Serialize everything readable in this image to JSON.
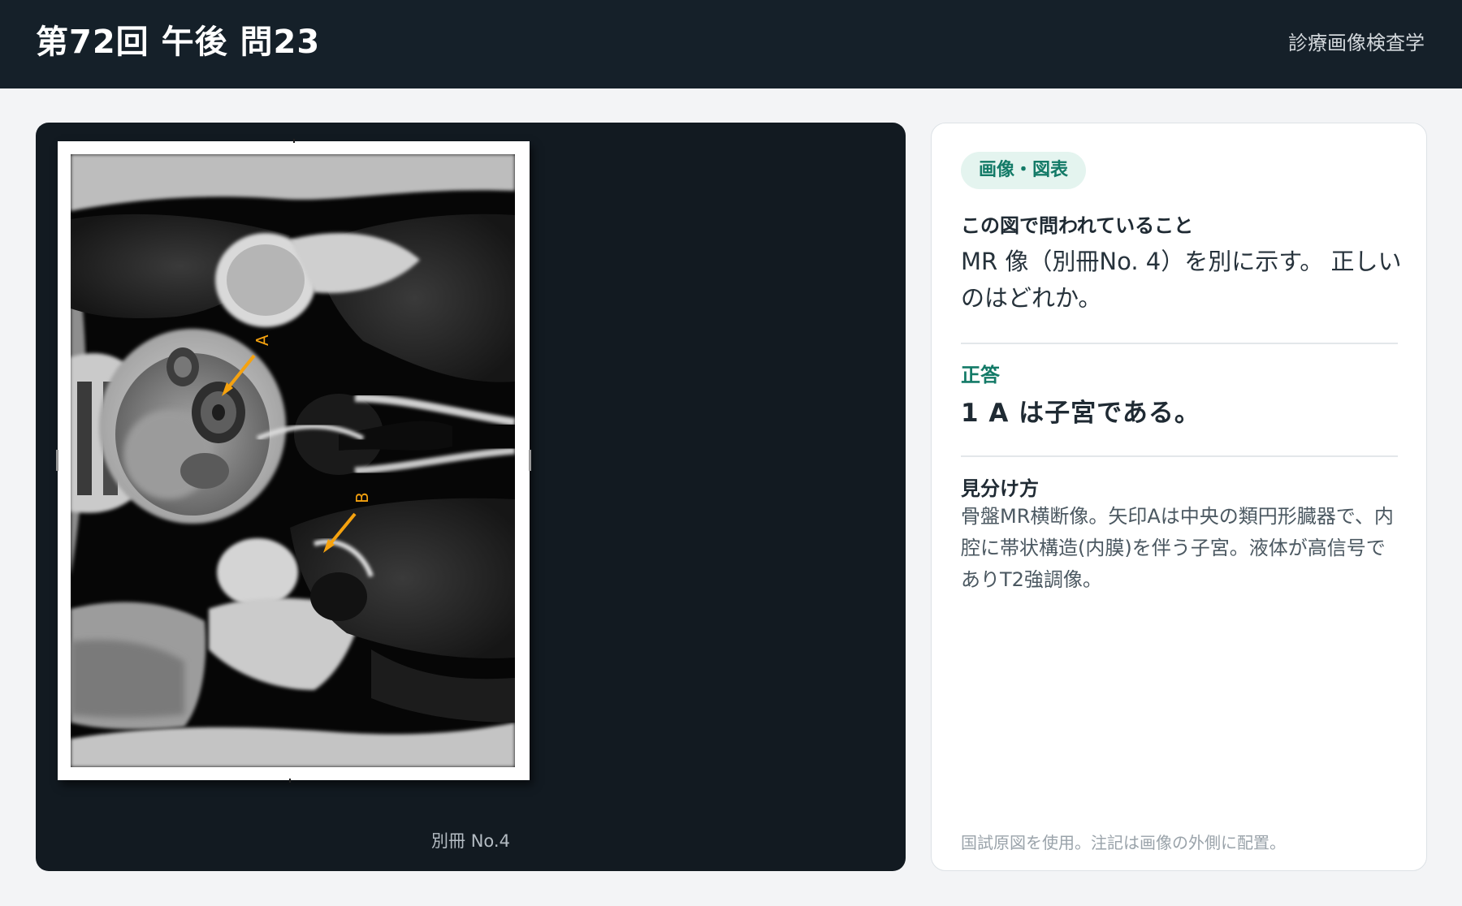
{
  "header": {
    "title": "第72回 午後 問23",
    "subject": "診療画像検査学"
  },
  "viewer": {
    "caption": "別冊 No.4",
    "arrow_labels": [
      "A",
      "B"
    ],
    "arrow_color": "#f5a20f"
  },
  "panel": {
    "badge": "画像・図表",
    "question_label": "この図で問われていること",
    "question_text": "MR 像（別冊No. 4）を別に示す。 正しいのはどれか。",
    "answer_label": "正答",
    "answer_text": "1 A は子宮である。",
    "howto_label": "見分け方",
    "howto_text": "骨盤MR横断像。矢印Aは中央の類円形臓器で、内腔に帯状構造(内膜)を伴う子宮。液体が高信号でありT2強調像。",
    "footnote": "国試原図を使用。注記は画像の外側に配置。"
  },
  "colors": {
    "header_bg": "#152029",
    "viewer_bg": "#121a21",
    "accent_green": "#137a67",
    "badge_bg": "#e4f4ef"
  }
}
